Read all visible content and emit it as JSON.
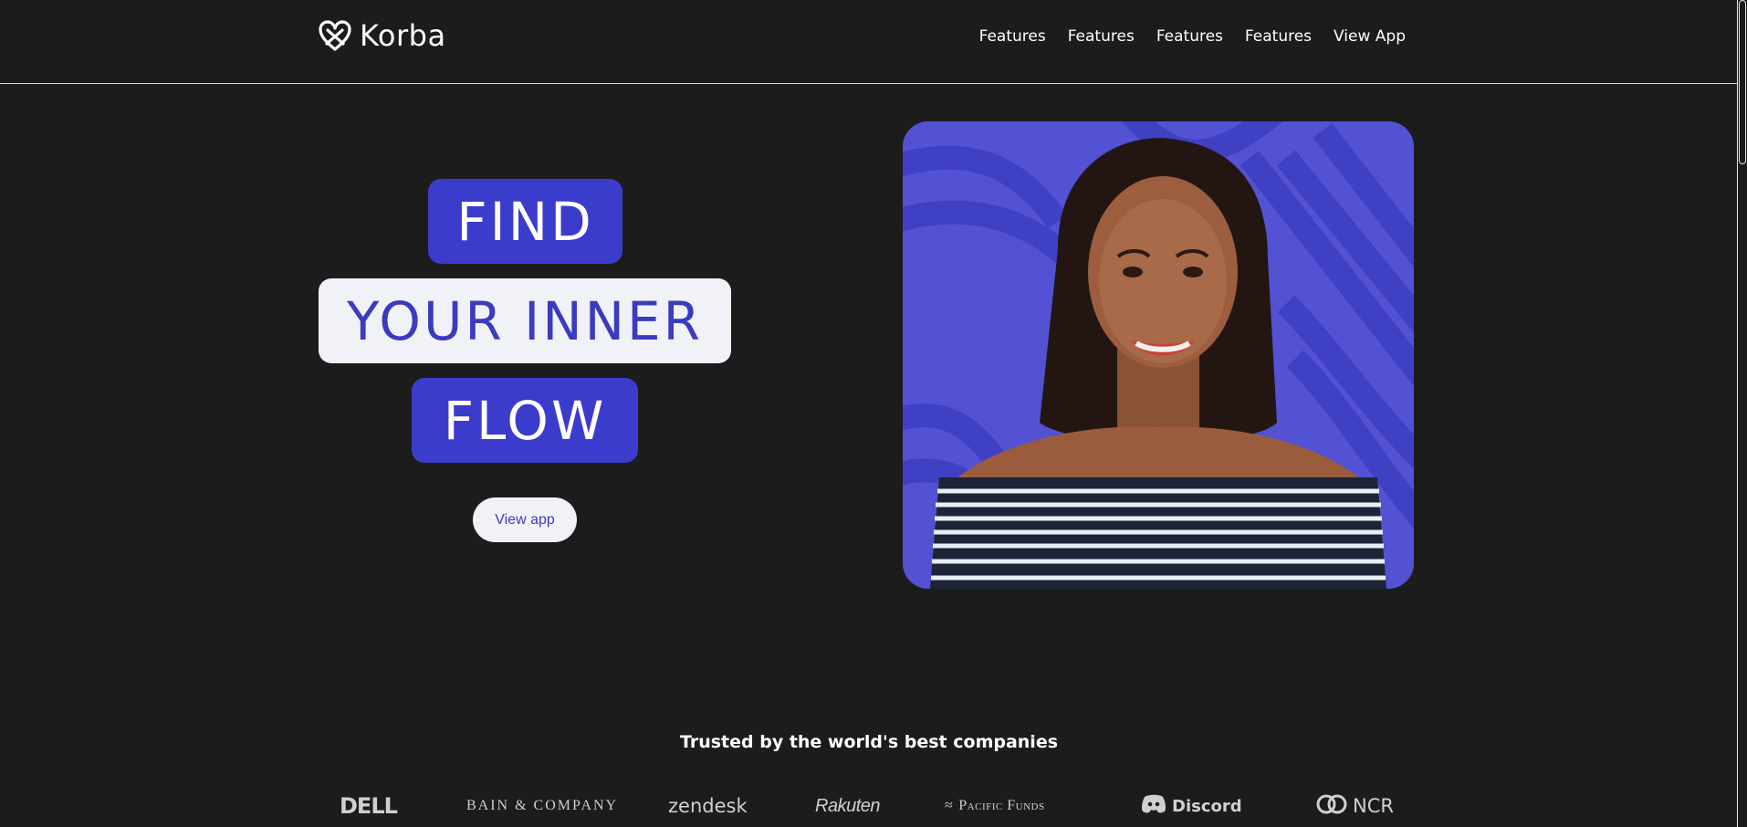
{
  "header": {
    "brand_name": "Korba",
    "nav": [
      "Features",
      "Features",
      "Features",
      "Features",
      "View App"
    ]
  },
  "hero": {
    "line1": "FIND",
    "line2": "YOUR INNER",
    "line3": "FLOW",
    "cta_label": "View app"
  },
  "trusted": {
    "heading": "Trusted by the world's best companies",
    "companies": [
      "DELL",
      "BAIN & COMPANY",
      "zendesk",
      "Rakuten",
      "Pacific Funds",
      "Discord",
      "NCR"
    ]
  },
  "colors": {
    "background": "#1c1c1c",
    "accent": "#3c3ccc",
    "light": "#f1f2f8"
  }
}
